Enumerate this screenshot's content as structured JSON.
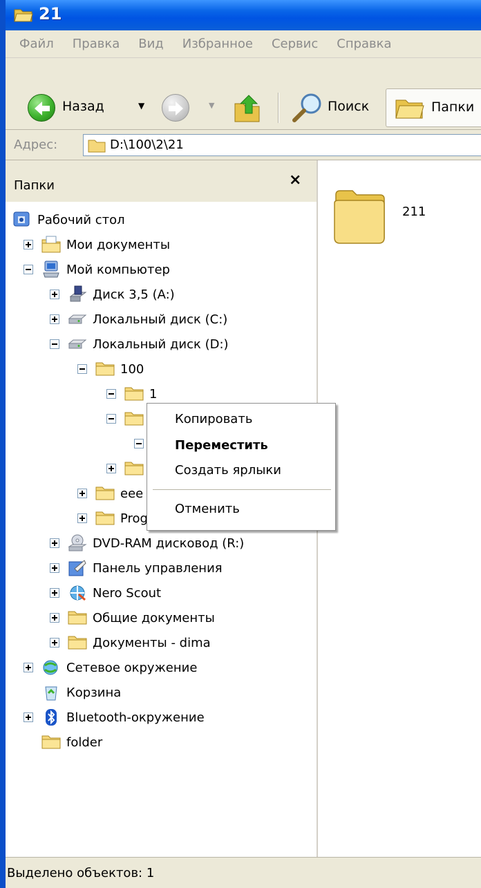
{
  "window": {
    "title": "21"
  },
  "menu": [
    "Файл",
    "Правка",
    "Вид",
    "Избранное",
    "Сервис",
    "Справка"
  ],
  "toolbar": {
    "back_label": "Назад",
    "search_label": "Поиск",
    "folders_label": "Папки"
  },
  "address": {
    "label": "Адрес:",
    "value": "D:\\100\\2\\21"
  },
  "folders_pane": {
    "title": "Папки",
    "close": "×",
    "tree": [
      {
        "label": "Рабочий стол",
        "level": 0,
        "toggle": "none",
        "icon": "desktop-icon"
      },
      {
        "label": "Мои документы",
        "level": 1,
        "toggle": "plus",
        "icon": "my-documents-icon"
      },
      {
        "label": "Мой компьютер",
        "level": 1,
        "toggle": "minus",
        "icon": "my-computer-icon"
      },
      {
        "label": "Диск 3,5 (A:)",
        "level": 2,
        "toggle": "plus",
        "icon": "floppy-drive-icon"
      },
      {
        "label": "Локальный диск (C:)",
        "level": 2,
        "toggle": "plus",
        "icon": "hard-drive-icon"
      },
      {
        "label": "Локальный диск (D:)",
        "level": 2,
        "toggle": "minus",
        "icon": "hard-drive-icon"
      },
      {
        "label": "100",
        "level": 3,
        "toggle": "minus",
        "icon": "folder-icon"
      },
      {
        "label": "1",
        "level": 4,
        "toggle": "minus",
        "icon": "folder-icon"
      },
      {
        "label": "",
        "level": 4,
        "toggle": "minus",
        "icon": "folder-icon"
      },
      {
        "label": "",
        "level": 5,
        "toggle": "minus",
        "icon": "folder-icon"
      },
      {
        "label": "",
        "level": 4,
        "toggle": "plus",
        "icon": "folder-icon"
      },
      {
        "label": "eee",
        "level": 3,
        "toggle": "plus",
        "icon": "folder-icon"
      },
      {
        "label": "Program Files",
        "level": 3,
        "toggle": "plus",
        "icon": "folder-icon"
      },
      {
        "label": "DVD-RAM дисковод (R:)",
        "level": 2,
        "toggle": "plus",
        "icon": "dvd-drive-icon"
      },
      {
        "label": "Панель управления",
        "level": 2,
        "toggle": "plus",
        "icon": "control-panel-icon"
      },
      {
        "label": "Nero Scout",
        "level": 2,
        "toggle": "plus",
        "icon": "nero-scout-icon"
      },
      {
        "label": "Общие документы",
        "level": 2,
        "toggle": "plus",
        "icon": "folder-icon"
      },
      {
        "label": "Документы - dima",
        "level": 2,
        "toggle": "plus",
        "icon": "folder-icon"
      },
      {
        "label": "Сетевое окружение",
        "level": 1,
        "toggle": "plus",
        "icon": "network-icon"
      },
      {
        "label": "Корзина",
        "level": 1,
        "toggle": "none",
        "icon": "recycle-bin-icon"
      },
      {
        "label": "Bluetooth-окружение",
        "level": 1,
        "toggle": "plus",
        "icon": "bluetooth-icon"
      },
      {
        "label": "folder",
        "level": 1,
        "toggle": "none",
        "icon": "folder-icon"
      }
    ]
  },
  "content": {
    "items": [
      {
        "label": "211",
        "icon": "folder-icon"
      }
    ]
  },
  "context_menu": {
    "items": [
      "Копировать",
      "Переместить",
      "Создать ярлыки",
      "Отменить"
    ],
    "default_item": "Переместить"
  },
  "status": {
    "text": "Выделено объектов: 1"
  },
  "colors": {
    "titlebar": "#0054e3",
    "chrome": "#ece9d8",
    "folder": "#f5d77a"
  }
}
